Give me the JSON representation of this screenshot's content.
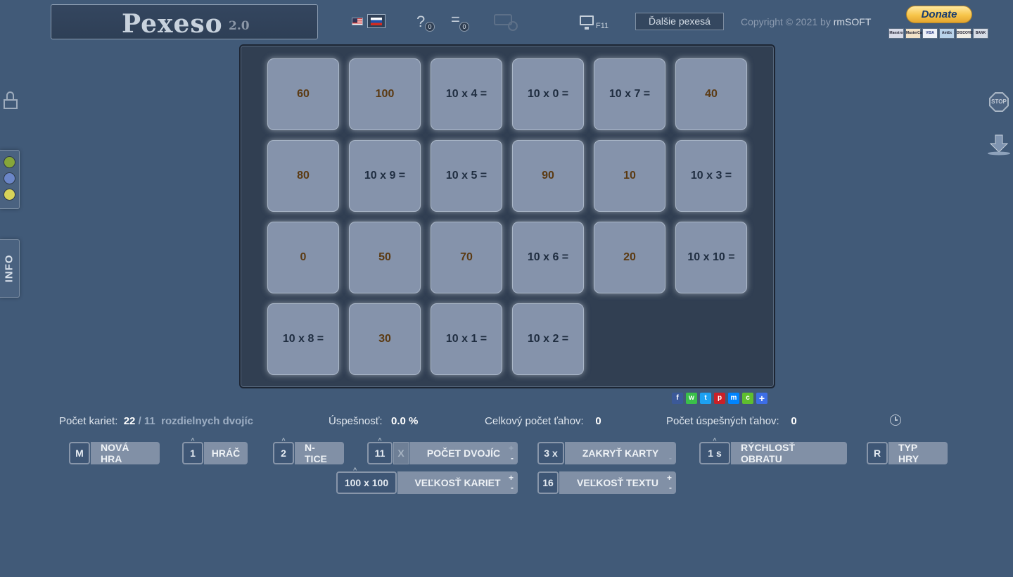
{
  "header": {
    "title": "Pexeso",
    "version": "2.0",
    "help_badge": "0",
    "list_badge": "0",
    "f11_label": "F11",
    "more_games": "Ďalšie pexesá",
    "copyright_prefix": "Copyright © 2021 by",
    "copyright_owner": "rmSOFT",
    "donate": "Donate",
    "payment_cards": [
      "Maestro",
      "MasterCard",
      "VISA",
      "AmEx",
      "DISCOVER",
      "BANK"
    ]
  },
  "side": {
    "info_label": "INFO",
    "stop_label": "STOP",
    "player_colors": [
      "#86a63a",
      "#6b86c8",
      "#d7d35a"
    ]
  },
  "cards": [
    {
      "text": "60",
      "kind": "a"
    },
    {
      "text": "100",
      "kind": "a"
    },
    {
      "text": "10 x 4 =",
      "kind": "q"
    },
    {
      "text": "10 x 0 =",
      "kind": "q"
    },
    {
      "text": "10 x 7 =",
      "kind": "q"
    },
    {
      "text": "40",
      "kind": "a"
    },
    {
      "text": "80",
      "kind": "a"
    },
    {
      "text": "10 x 9 =",
      "kind": "q"
    },
    {
      "text": "10 x 5 =",
      "kind": "q"
    },
    {
      "text": "90",
      "kind": "a"
    },
    {
      "text": "10",
      "kind": "a"
    },
    {
      "text": "10 x 3 =",
      "kind": "q"
    },
    {
      "text": "0",
      "kind": "a"
    },
    {
      "text": "50",
      "kind": "a"
    },
    {
      "text": "70",
      "kind": "a"
    },
    {
      "text": "10 x 6 =",
      "kind": "q"
    },
    {
      "text": "20",
      "kind": "a"
    },
    {
      "text": "10 x 10 =",
      "kind": "q"
    },
    {
      "text": "10 x 8 =",
      "kind": "q"
    },
    {
      "text": "30",
      "kind": "a"
    },
    {
      "text": "10 x 1 =",
      "kind": "q"
    },
    {
      "text": "10 x 2 =",
      "kind": "q"
    }
  ],
  "share_icons": [
    "facebook",
    "whatsapp",
    "twitter",
    "pinterest",
    "messenger",
    "wechat",
    "share-more"
  ],
  "stats": {
    "cards_label": "Počet kariet:",
    "cards_value": "22",
    "cards_sep": "/",
    "pairs_value": "11",
    "pairs_label": "rozdielnych dvojíc",
    "success_label": "Úspešnosť:",
    "success_value": "0.0 %",
    "moves_label": "Celkový počet ťahov:",
    "moves_value": "0",
    "good_moves_label": "Počet úspešných ťahov:",
    "good_moves_value": "0"
  },
  "controls": {
    "new_game": {
      "key": "M",
      "label": "NOVÁ HRA"
    },
    "players": {
      "key": "1",
      "label": "HRÁČ"
    },
    "ntuples": {
      "key": "2",
      "label": "N-TICE"
    },
    "pairs": {
      "key": "11",
      "x": "X",
      "label": "POČET DVOJÍC",
      "plus": "+",
      "minus": "-"
    },
    "hide_cards": {
      "key": "3 x",
      "label": "ZAKRYŤ KARTY",
      "minus": "-"
    },
    "flip_speed": {
      "key": "1 s",
      "label": "RÝCHLOSŤ OBRATU"
    },
    "game_type": {
      "key": "R",
      "label": "TYP HRY"
    },
    "card_size": {
      "key": "100 x 100",
      "label": "VEĽKOSŤ KARIET",
      "plus": "+",
      "minus": "-"
    },
    "text_size": {
      "key": "16",
      "label": "VEĽKOSŤ TEXTU",
      "plus": "+",
      "minus": "-"
    }
  }
}
